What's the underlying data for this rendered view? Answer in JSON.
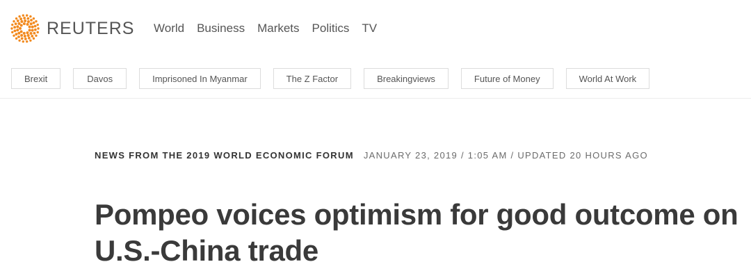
{
  "brand": {
    "name": "REUTERS",
    "logo_icon": "reuters-dot-logo-icon",
    "logo_color": "#f28a1f"
  },
  "nav": {
    "items": [
      "World",
      "Business",
      "Markets",
      "Politics",
      "TV"
    ]
  },
  "topics": [
    "Brexit",
    "Davos",
    "Imprisoned In Myanmar",
    "The Z Factor",
    "Breakingviews",
    "Future of Money",
    "World At Work"
  ],
  "article": {
    "kicker": "NEWS FROM THE 2019 WORLD ECONOMIC FORUM",
    "dateline": "JANUARY 23, 2019 / 1:05 AM / UPDATED 20 HOURS AGO",
    "headline": "Pompeo voices optimism for good outcome on U.S.-China trade"
  }
}
